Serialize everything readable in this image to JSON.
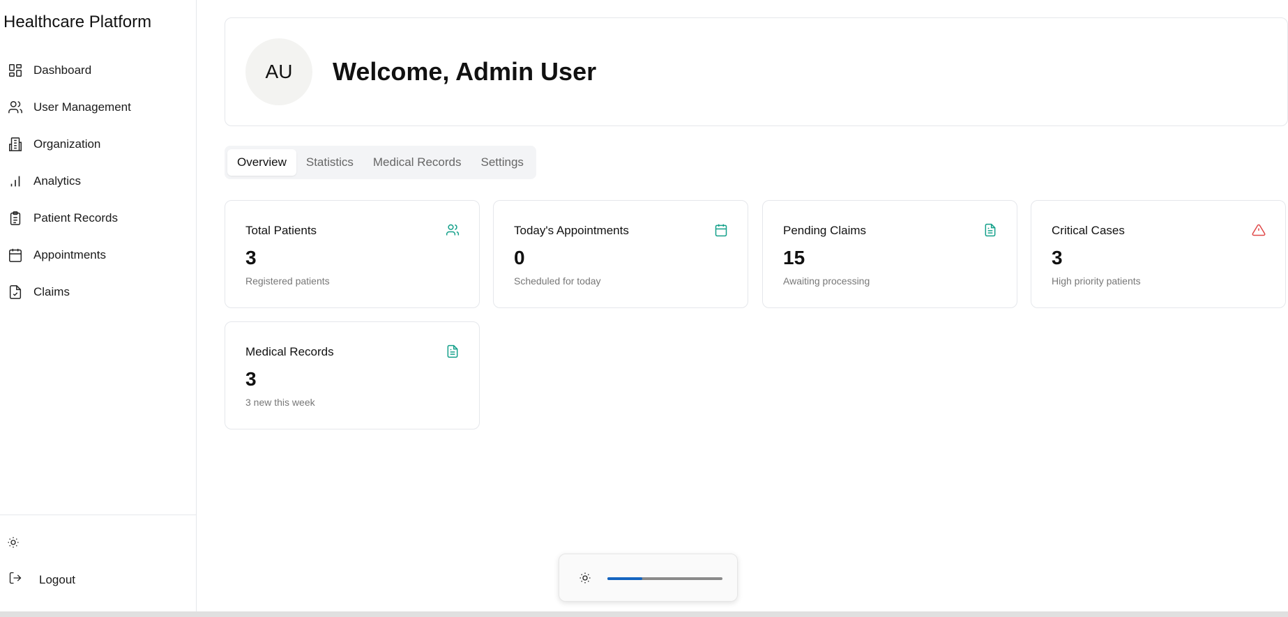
{
  "app": {
    "title": "Healthcare Platform"
  },
  "sidebar": {
    "items": [
      {
        "label": "Dashboard",
        "icon": "dashboard-icon"
      },
      {
        "label": "User Management",
        "icon": "users-icon"
      },
      {
        "label": "Organization",
        "icon": "building-icon"
      },
      {
        "label": "Analytics",
        "icon": "bar-chart-icon"
      },
      {
        "label": "Patient Records",
        "icon": "clipboard-icon"
      },
      {
        "label": "Appointments",
        "icon": "calendar-icon"
      },
      {
        "label": "Claims",
        "icon": "file-check-icon"
      }
    ],
    "theme_toggle_icon": "sun-icon",
    "logout_label": "Logout"
  },
  "welcome": {
    "avatar_initials": "AU",
    "title": "Welcome, Admin User"
  },
  "tabs": [
    {
      "label": "Overview",
      "active": true
    },
    {
      "label": "Statistics",
      "active": false
    },
    {
      "label": "Medical Records",
      "active": false
    },
    {
      "label": "Settings",
      "active": false
    }
  ],
  "stats": [
    {
      "title": "Total Patients",
      "value": "3",
      "subtitle": "Registered patients",
      "icon": "users-icon",
      "icon_color": "#14a08a"
    },
    {
      "title": "Today's Appointments",
      "value": "0",
      "subtitle": "Scheduled for today",
      "icon": "calendar-icon",
      "icon_color": "#14a08a"
    },
    {
      "title": "Pending Claims",
      "value": "15",
      "subtitle": "Awaiting processing",
      "icon": "file-text-icon",
      "icon_color": "#14a08a"
    },
    {
      "title": "Critical Cases",
      "value": "3",
      "subtitle": "High priority patients",
      "icon": "alert-triangle-icon",
      "icon_color": "#e04848"
    },
    {
      "title": "Medical Records",
      "value": "3",
      "subtitle": "3 new this week",
      "icon": "file-text-icon",
      "icon_color": "#14a08a"
    }
  ],
  "brightness": {
    "icon": "sun-icon",
    "level": 0.3,
    "accent": "#1565c0"
  }
}
